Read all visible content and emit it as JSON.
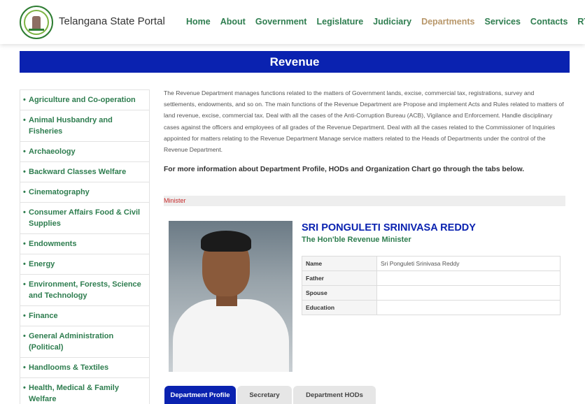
{
  "header": {
    "site_title": "Telangana State Portal",
    "logo_icon": "telangana-emblem-icon",
    "nav": [
      {
        "label": "Home",
        "active": false
      },
      {
        "label": "About",
        "active": false
      },
      {
        "label": "Government",
        "active": false
      },
      {
        "label": "Legislature",
        "active": false
      },
      {
        "label": "Judiciary",
        "active": false
      },
      {
        "label": "Departments",
        "active": true
      },
      {
        "label": "Services",
        "active": false
      },
      {
        "label": "Contacts",
        "active": false
      },
      {
        "label": "RTI",
        "active": false
      }
    ]
  },
  "banner": {
    "title": "Revenue"
  },
  "sidebar": {
    "items": [
      {
        "label": "Agriculture and Co-operation"
      },
      {
        "label": "Animal Husbandry and Fisheries"
      },
      {
        "label": "Archaeology"
      },
      {
        "label": "Backward Classes Welfare"
      },
      {
        "label": "Cinematography"
      },
      {
        "label": "Consumer Affairs Food & Civil Supplies"
      },
      {
        "label": "Endowments"
      },
      {
        "label": "Energy"
      },
      {
        "label": "Environment, Forests, Science and Technology"
      },
      {
        "label": "Finance"
      },
      {
        "label": "General Administration (Political)"
      },
      {
        "label": "Handlooms & Textiles"
      },
      {
        "label": "Health, Medical & Family Welfare"
      }
    ]
  },
  "main": {
    "description": "The Revenue Department manages functions related to the matters of Government lands, excise, commercial tax, registrations, survey and settlements, endowments, and so on. The main functions of the Revenue Department are Propose and implement Acts and Rules related to matters of land revenue, excise, commercial tax. Deal with all the cases of the Anti-Corruption Bureau (ACB), Vigilance and Enforcement. Handle disciplinary cases against the officers and employees of all grades of the Revenue Department. Deal with all the cases related to the Commissioner of Inquiries appointed for matters relating to the Revenue Department Manage service matters related to the Heads of Departments under the control of the Revenue Department.",
    "more_info": "For more information about Department Profile, HODs and Organization Chart go through the tabs below.",
    "section_label": "Minister",
    "minister": {
      "name": "SRI PONGULETI SRINIVASA REDDY",
      "role": "The Hon'ble Revenue Minister",
      "fields": [
        {
          "key": "Name",
          "value": "Sri Ponguleti Srinivasa Reddy"
        },
        {
          "key": "Father",
          "value": ""
        },
        {
          "key": "Spouse",
          "value": ""
        },
        {
          "key": "Education",
          "value": ""
        }
      ]
    },
    "tabs": [
      {
        "label": "Department Profile",
        "active": true
      },
      {
        "label": "Secretary",
        "active": false
      },
      {
        "label": "Department HODs",
        "active": false
      }
    ]
  },
  "colors": {
    "primary_blue": "#0a22b0",
    "nav_green": "#2e7d4f",
    "active_nav": "#b8976a",
    "minister_label": "#c62828"
  }
}
